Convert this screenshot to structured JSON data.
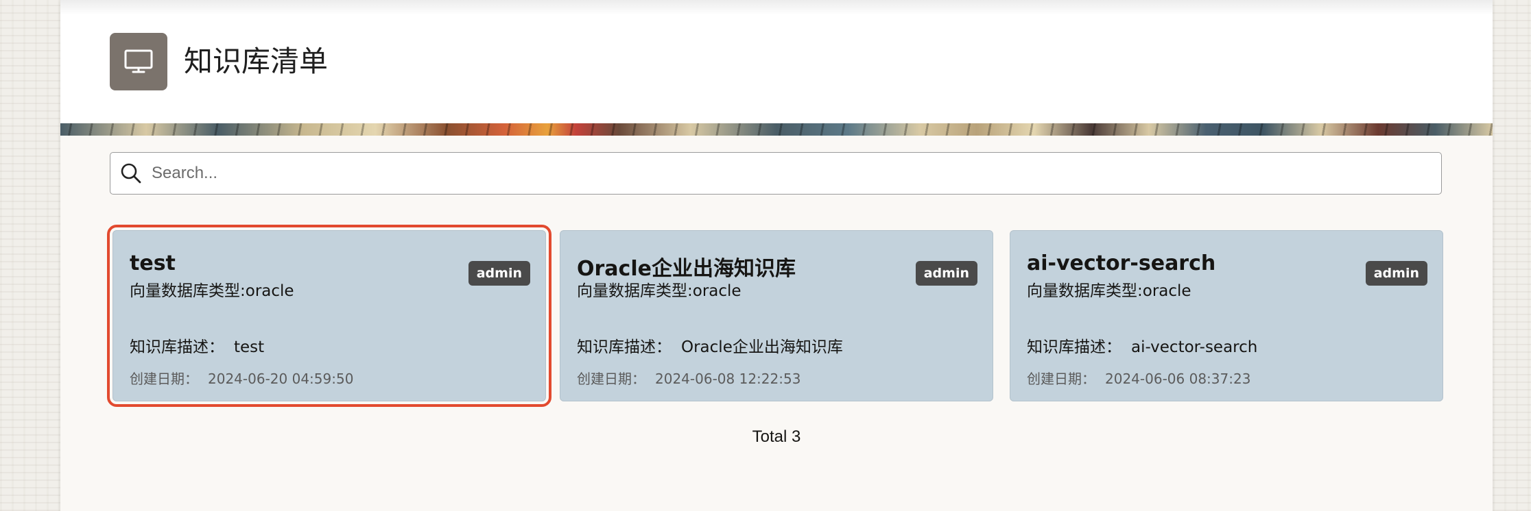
{
  "header": {
    "title": "知识库清单",
    "icon": "monitor-icon"
  },
  "search": {
    "placeholder": "Search...",
    "value": "",
    "icon": "search-icon"
  },
  "cards": [
    {
      "title": "test",
      "type_label": "向量数据库类型:oracle",
      "badge": "admin",
      "desc_label": "知识库描述：",
      "desc_value": "test",
      "date_label": "创建日期：",
      "date_value": "2024-06-20 04:59:50",
      "selected": true
    },
    {
      "title": "Oracle企业出海知识库",
      "type_label": "向量数据库类型:oracle",
      "badge": "admin",
      "desc_label": "知识库描述：",
      "desc_value": "Oracle企业出海知识库",
      "date_label": "创建日期：",
      "date_value": "2024-06-08 12:22:53",
      "selected": false
    },
    {
      "title": "ai-vector-search",
      "type_label": "向量数据库类型:oracle",
      "badge": "admin",
      "desc_label": "知识库描述：",
      "desc_value": "ai-vector-search",
      "date_label": "创建日期：",
      "date_value": "2024-06-06 08:37:23",
      "selected": false
    }
  ],
  "footer": {
    "total": "Total 3"
  },
  "colors": {
    "card_bg": "#c3d2dc",
    "badge_bg": "#4a4a4a",
    "selection_outline": "#e24a2f",
    "header_icon_bg": "#7b736c"
  }
}
